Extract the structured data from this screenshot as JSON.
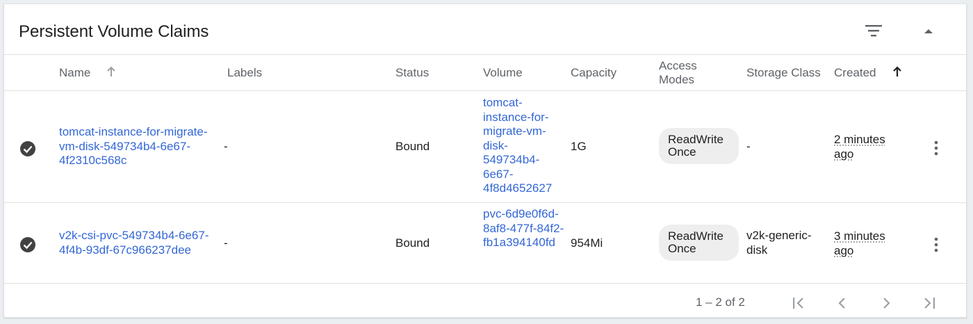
{
  "card": {
    "title": "Persistent Volume Claims",
    "filter_icon": "filter-list-icon",
    "collapse_icon": "arrow-drop-up-icon"
  },
  "columns": {
    "name": "Name",
    "labels": "Labels",
    "status": "Status",
    "volume": "Volume",
    "capacity": "Capacity",
    "access_modes": "Access Modes",
    "storage_class": "Storage Class",
    "created": "Created"
  },
  "rows": [
    {
      "status_icon": "check-circle-icon",
      "name": "tomcat-instance-for-migrate-vm-disk-549734b4-6e67-4f2310c568c",
      "labels": "-",
      "status": "Bound",
      "volume": "tomcat-instance-for-migrate-vm-disk-549734b4-6e67-4f8d4652627",
      "capacity": "1G",
      "access_mode": "ReadWrite Once",
      "storage_class": "-",
      "created": "2 minutes ago",
      "menu_icon": "more-vert-icon"
    },
    {
      "status_icon": "check-circle-icon",
      "name": "v2k-csi-pvc-549734b4-6e67-4f4b-93df-67c966237dee",
      "labels": "-",
      "status": "Bound",
      "volume": "pvc-6d9e0f6d-8af8-477f-84f2-fb1a394140fd",
      "capacity": "954Mi",
      "access_mode": "ReadWrite Once",
      "storage_class": "v2k-generic-disk",
      "created": "3 minutes ago",
      "menu_icon": "more-vert-icon"
    }
  ],
  "pagination": {
    "range": "1 – 2 of 2",
    "first_icon": "first-page-icon",
    "prev_icon": "chevron-left-icon",
    "next_icon": "chevron-right-icon",
    "last_icon": "last-page-icon"
  },
  "colors": {
    "link": "#3367d6",
    "status_ok": "#424242",
    "chip_bg": "#eeeeee",
    "muted": "#5f6368"
  }
}
